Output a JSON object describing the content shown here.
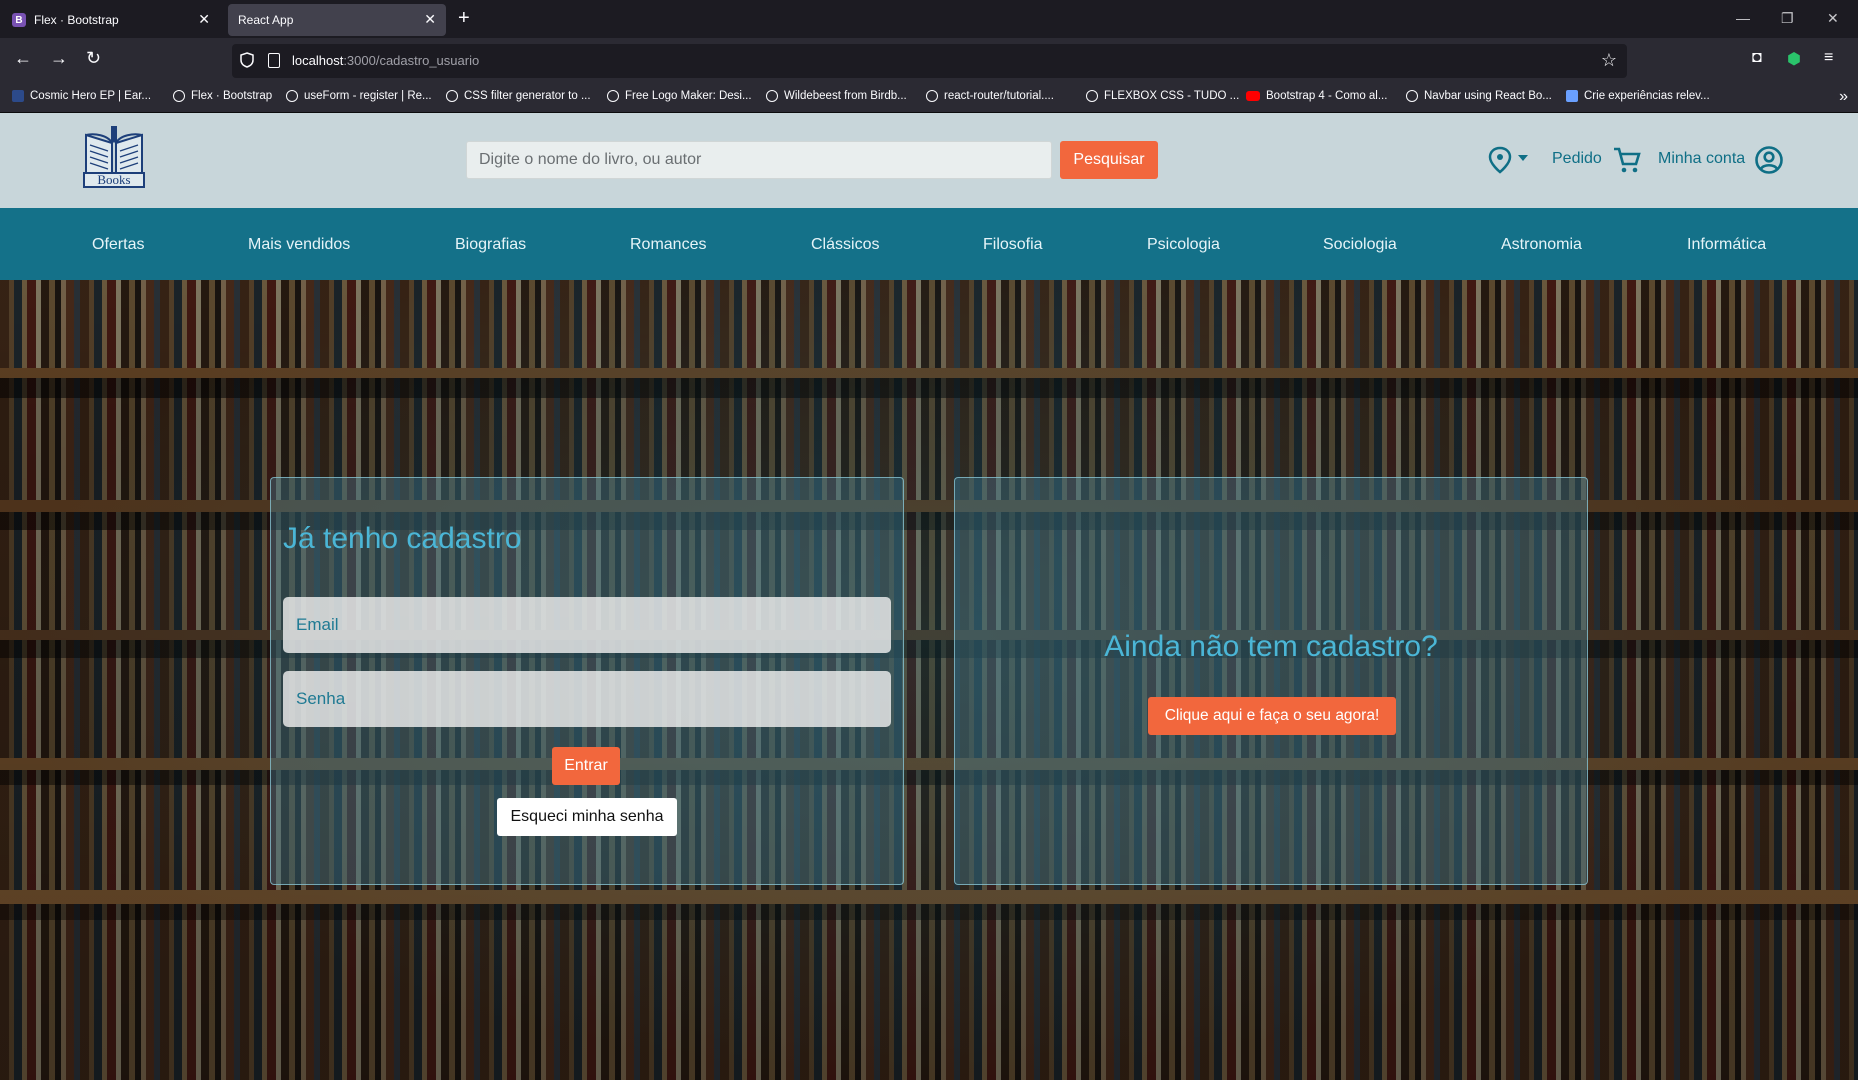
{
  "browser": {
    "tabs": [
      {
        "title": "Flex · Bootstrap",
        "favicon": "B"
      },
      {
        "title": "React App"
      }
    ],
    "url_host": "localhost",
    "url_path": ":3000/cadastro_usuario",
    "bookmarks": [
      "Cosmic Hero EP | Ear...",
      "Flex · Bootstrap",
      "useForm - register | Re...",
      "CSS filter generator to ...",
      "Free Logo Maker: Desi...",
      "Wildebeest from Birdb...",
      "react-router/tutorial....",
      "FLEXBOX CSS - TUDO ...",
      "Bootstrap 4 - Como al...",
      "Navbar using React Bo...",
      "Crie experiências relev..."
    ]
  },
  "header": {
    "logo_text": "Books",
    "search_placeholder": "Digite o nome do livro, ou autor",
    "search_button": "Pesquisar",
    "order_label": "Pedido",
    "account_label": "Minha conta"
  },
  "categories": [
    "Ofertas",
    "Mais vendidos",
    "Biografias",
    "Romances",
    "Clássicos",
    "Filosofia",
    "Psicologia",
    "Sociologia",
    "Astronomia",
    "Informática"
  ],
  "login": {
    "title": "Já tenho cadastro",
    "email_placeholder": "Email",
    "password_placeholder": "Senha",
    "submit_label": "Entrar",
    "forgot_label": "Esqueci minha senha"
  },
  "register": {
    "title": "Ainda não tem cadastro?",
    "button_label": "Clique aqui e faça o seu agora!"
  },
  "colors": {
    "header_bg": "#c8d6da",
    "nav_bg": "#147189",
    "accent": "#f2673d",
    "title_color": "#4bb6d6"
  }
}
